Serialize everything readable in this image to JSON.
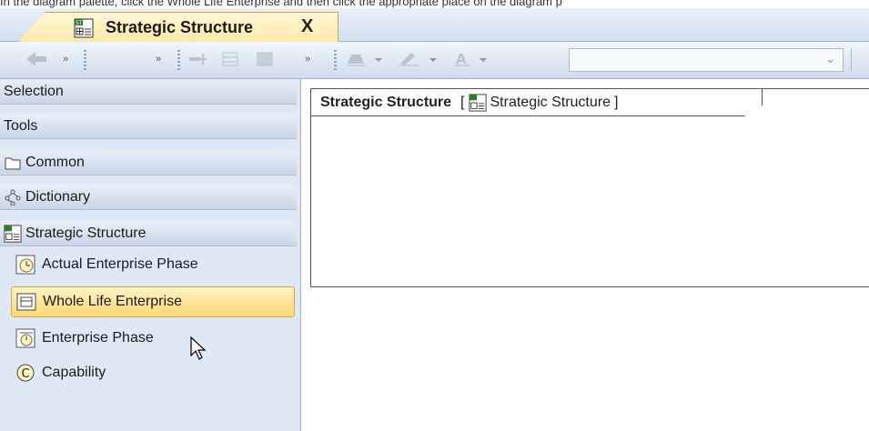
{
  "caption": "In the diagram palette, click the Whole Life Enterprise and then click the appropriate place on the diagram p",
  "tab": {
    "title": "Strategic Structure",
    "close": "X"
  },
  "toolbar": {
    "combo_value": "",
    "icons": [
      "back-arrow-icon",
      "overflow-icon",
      "overflow-icon",
      "insert-icon",
      "grid-icon",
      "image-icon",
      "overflow-icon",
      "fill-color-icon",
      "line-color-icon",
      "font-color-icon"
    ]
  },
  "palette": {
    "categories": [
      {
        "label": "Selection",
        "icon": ""
      },
      {
        "label": "Tools",
        "icon": ""
      },
      {
        "label": "Common",
        "icon": "folder-icon"
      },
      {
        "label": "Dictionary",
        "icon": "dictionary-icon"
      },
      {
        "label": "Strategic Structure",
        "icon": "strategic-structure-icon"
      }
    ],
    "tools": [
      {
        "label": "Actual Enterprise Phase",
        "icon": "actual-enterprise-phase-icon"
      },
      {
        "label": "Whole Life Enterprise",
        "icon": "whole-life-enterprise-icon",
        "selected": true
      },
      {
        "label": "Enterprise Phase",
        "icon": "enterprise-phase-icon"
      },
      {
        "label": "Capability",
        "icon": "capability-icon"
      }
    ]
  },
  "diagram": {
    "name": "Strategic Structure",
    "bracket_open": "[",
    "type_label": "Strategic Structure",
    "bracket_close": "]"
  },
  "colors": {
    "selection": "#ffd873",
    "palette_bg": "#dfe9f6",
    "frame": "#dce7f5"
  }
}
